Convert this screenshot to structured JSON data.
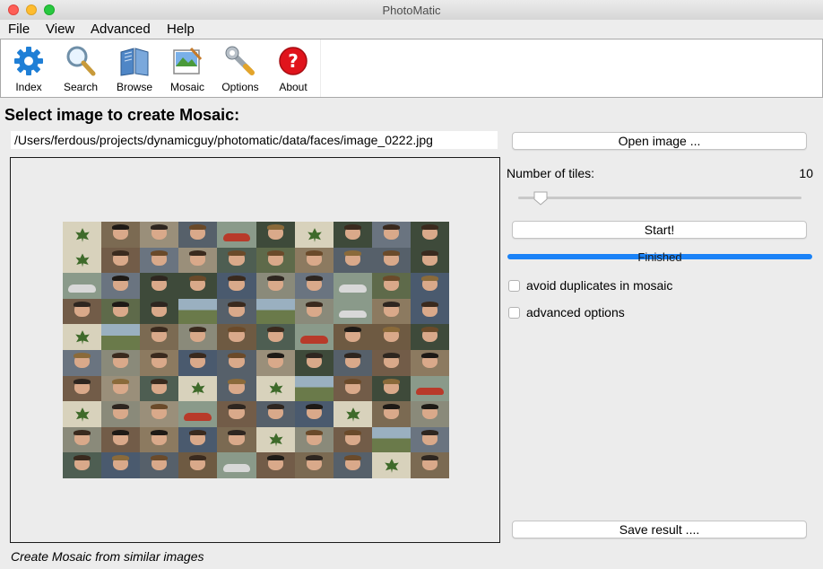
{
  "window": {
    "title": "PhotoMatic"
  },
  "menu": {
    "items": [
      "File",
      "View",
      "Advanced",
      "Help"
    ]
  },
  "toolbar": {
    "tools": [
      {
        "label": "Index",
        "icon": "gear-icon"
      },
      {
        "label": "Search",
        "icon": "magnifier-icon"
      },
      {
        "label": "Browse",
        "icon": "book-icon"
      },
      {
        "label": "Mosaic",
        "icon": "mosaic-icon"
      },
      {
        "label": "Options",
        "icon": "wrench-icon"
      },
      {
        "label": "About",
        "icon": "help-icon"
      }
    ]
  },
  "main": {
    "heading": "Select image to create Mosaic:",
    "path": "/Users/ferdous/projects/dynamicguy/photomatic/data/faces/image_0222.jpg",
    "open_button": "Open image ...",
    "tiles_label": "Number of tiles:",
    "tiles_value": "10",
    "tiles_slider_fraction": 0.08,
    "start_button": "Start!",
    "progress_text": "Finished",
    "progress_fraction": 1.0,
    "avoid_duplicates_label": "avoid duplicates in mosaic",
    "avoid_duplicates_checked": false,
    "advanced_label": "advanced options",
    "advanced_checked": false,
    "save_button": "Save result ...."
  },
  "status": {
    "text": "Create Mosaic from similar images"
  },
  "colors": {
    "accent": "#1a82f7",
    "background": "#ececec",
    "close": "#fe5f57",
    "minimize": "#febc2e",
    "maximize": "#28c840"
  }
}
